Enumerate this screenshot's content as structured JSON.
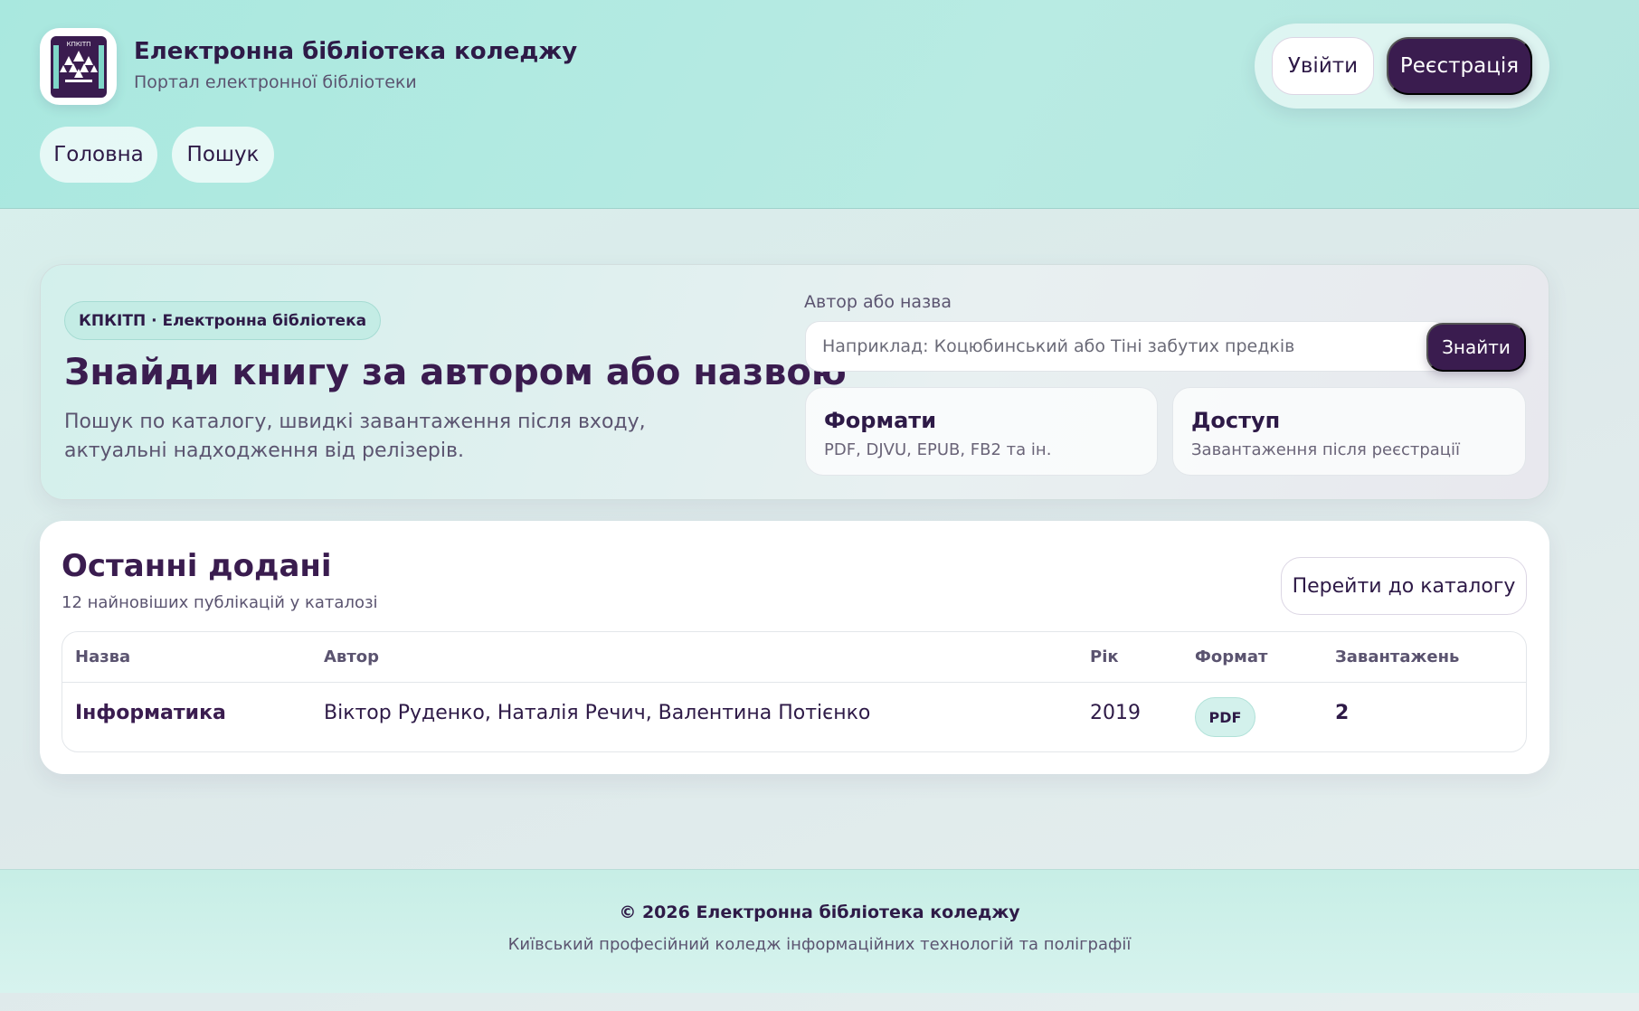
{
  "header": {
    "title": "Електронна бібліотека коледжу",
    "subtitle": "Портал електронної бібліотеки",
    "logo_text": "КПКІТП",
    "nav": [
      {
        "label": "Головна"
      },
      {
        "label": "Пошук"
      }
    ],
    "login_label": "Увійти",
    "register_label": "Реєстрація"
  },
  "hero": {
    "badge": "КПКІТП · Електронна бібліотека",
    "title": "Знайди книгу за автором або назвою",
    "description": "Пошук по каталогу, швидкі завантаження після входу, актуальні надходження від релізерів.",
    "search_label": "Автор або назва",
    "search_placeholder": "Наприклад: Коцюбинський або Тіні забутих предків",
    "search_value": "",
    "find_label": "Знайти",
    "cards": [
      {
        "title": "Формати",
        "text": "PDF, DJVU, EPUB, FB2 та ін."
      },
      {
        "title": "Доступ",
        "text": "Завантаження після реєстрації"
      }
    ]
  },
  "recent": {
    "title": "Останні додані",
    "subtitle": "12 найновіших публікацій у каталозі",
    "catalog_label": "Перейти до каталогу",
    "columns": [
      "Назва",
      "Автор",
      "Рік",
      "Формат",
      "Завантажень"
    ],
    "rows": [
      {
        "title": "Інформатика",
        "author": "Віктор Руденко, Наталія Речич, Валентина Потієнко",
        "year": "2019",
        "format": "PDF",
        "downloads": "2"
      }
    ]
  },
  "footer": {
    "copyright": "© 2026 Електронна бібліотека коледжу",
    "org": "Київський професійний коледж інформаційних технологій та поліграфії"
  },
  "colors": {
    "primary": "#3a1c4f",
    "accent": "#a9e8df",
    "text": "#2e1a47"
  },
  "icons": {
    "logo": "college-logo-icon"
  }
}
